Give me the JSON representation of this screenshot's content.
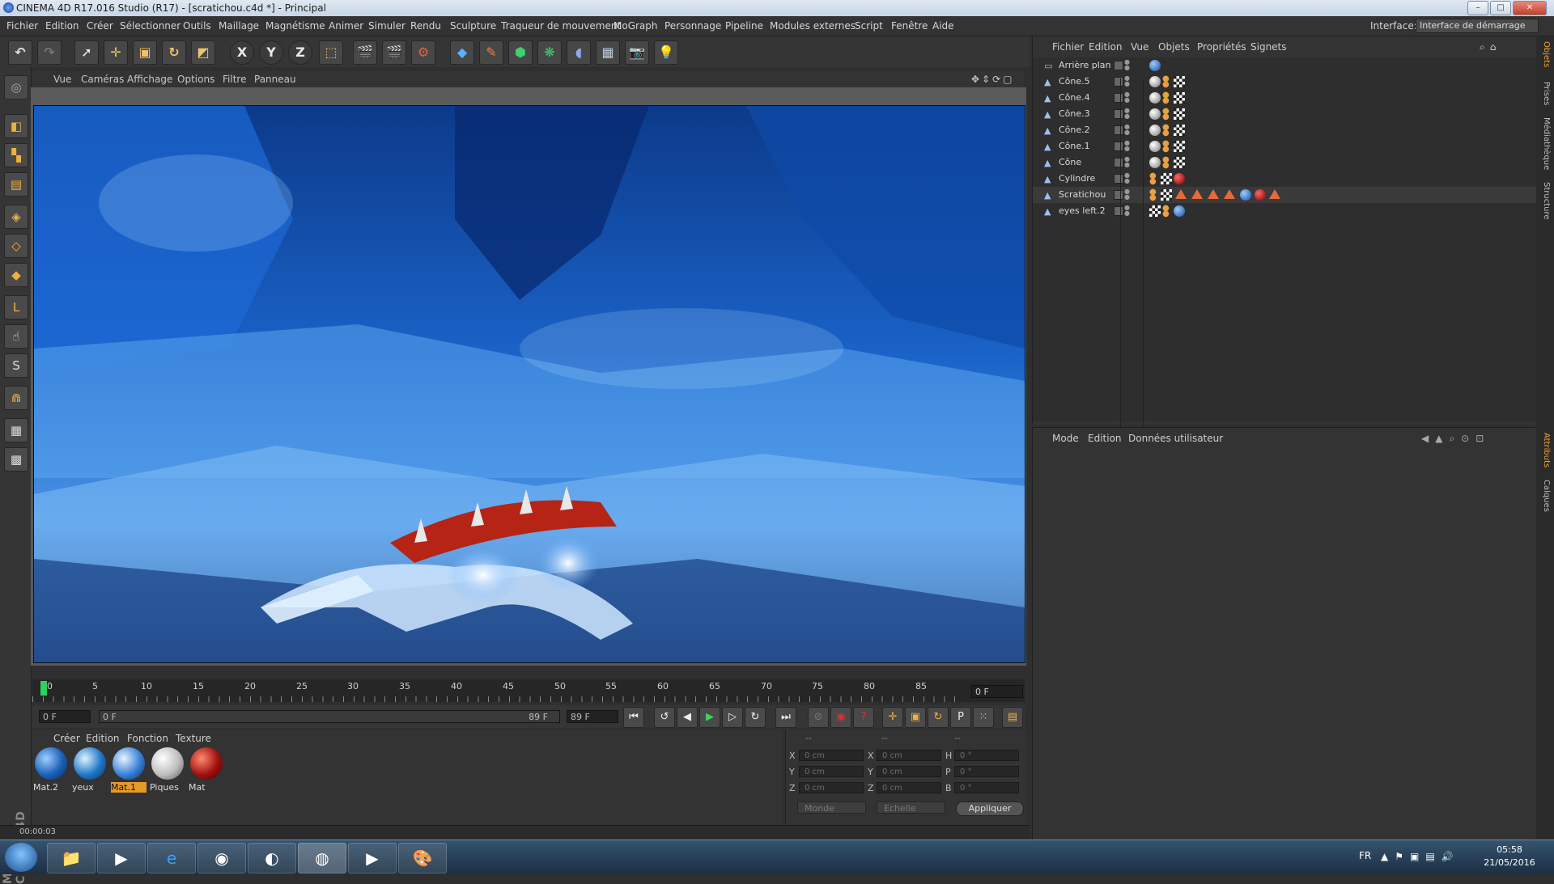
{
  "window": {
    "title": "CINEMA 4D R17.016 Studio (R17) - [scratichou.c4d *] - Principal",
    "controls": [
      "–",
      "□",
      "✕"
    ]
  },
  "menubar": {
    "items": [
      "Fichier",
      "Edition",
      "Créer",
      "Sélectionner",
      "Outils",
      "Maillage",
      "Magnétisme",
      "Animer",
      "Simuler",
      "Rendu",
      "Sculpture",
      "Traqueur de mouvement",
      "MoGraph",
      "Personnage",
      "Pipeline",
      "Modules externes",
      "Script",
      "Fenêtre",
      "Aide"
    ],
    "interface_label": "Interface:",
    "interface_value": "Interface de démarrage"
  },
  "toolbar": {
    "axis_x": "X",
    "axis_y": "Y",
    "axis_z": "Z"
  },
  "viewport": {
    "menu": [
      "Vue",
      "Caméras",
      "Affichage",
      "Options",
      "Filtre",
      "Panneau"
    ]
  },
  "timeline": {
    "ticks": [
      "0",
      "5",
      "10",
      "15",
      "20",
      "25",
      "30",
      "35",
      "40",
      "45",
      "50",
      "55",
      "60",
      "65",
      "70",
      "75",
      "80",
      "85"
    ],
    "current_frame": "0 F",
    "start_field": "0 F",
    "range_start": "0 F",
    "range_end": "89 F",
    "end_field": "89 F"
  },
  "materials": {
    "menu": [
      "Créer",
      "Edition",
      "Fonction",
      "Texture"
    ],
    "items": [
      {
        "name": "Mat.2",
        "color": "#1c5fb8",
        "selected": false
      },
      {
        "name": "yeux",
        "color": "#1f76c6",
        "selected": false
      },
      {
        "name": "Mat.1",
        "color": "#3a80d8",
        "selected": true
      },
      {
        "name": "Piques",
        "color": "#d8d8d8",
        "selected": false
      },
      {
        "name": "Mat",
        "color": "#a01010",
        "selected": false
      }
    ]
  },
  "coordinates": {
    "headers": [
      "--",
      "--",
      "--"
    ],
    "rows": [
      {
        "a": "X",
        "av": "0 cm",
        "b": "X",
        "bv": "0 cm",
        "c": "H",
        "cv": "0 °"
      },
      {
        "a": "Y",
        "av": "0 cm",
        "b": "Y",
        "bv": "0 cm",
        "c": "P",
        "cv": "0 °"
      },
      {
        "a": "Z",
        "av": "0 cm",
        "b": "Z",
        "bv": "0 cm",
        "c": "B",
        "cv": "0 °"
      }
    ],
    "mode1": "Monde",
    "mode2": "Echelle",
    "apply": "Appliquer"
  },
  "status": {
    "time": "00:00:03"
  },
  "object_manager": {
    "menu": [
      "Fichier",
      "Edition",
      "Vue",
      "Objets",
      "Propriétés",
      "Signets"
    ],
    "objects": [
      {
        "name": "Arrière plan"
      },
      {
        "name": "Cône.5"
      },
      {
        "name": "Cône.4"
      },
      {
        "name": "Cône.3"
      },
      {
        "name": "Cône.2"
      },
      {
        "name": "Cône.1"
      },
      {
        "name": "Cône"
      },
      {
        "name": "Cylindre"
      },
      {
        "name": "Scratichou"
      },
      {
        "name": "eyes left.2"
      }
    ]
  },
  "attributes": {
    "menu": [
      "Mode",
      "Edition",
      "Données utilisateur"
    ]
  },
  "right_tabs": [
    "Objets",
    "Prises",
    "Médiathèque",
    "Structure",
    "Attributs",
    "Calques"
  ],
  "taskbar": {
    "language": "FR",
    "time": "05:58",
    "date": "21/05/2016"
  }
}
